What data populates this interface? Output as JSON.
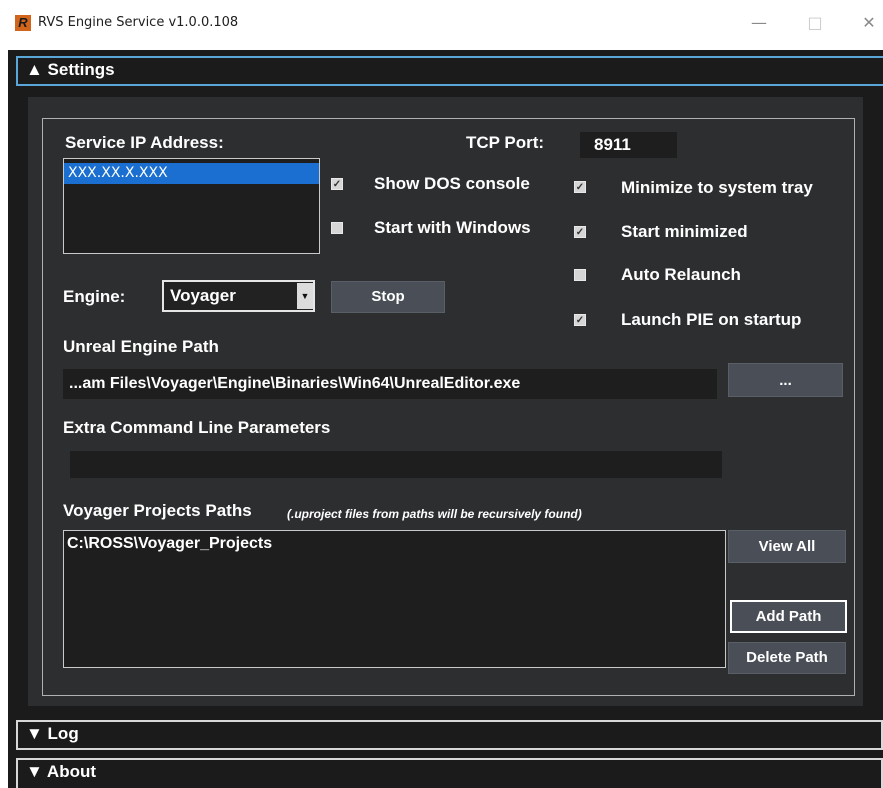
{
  "window": {
    "title": "RVS Engine Service v1.0.0.108",
    "logo_letter": "R",
    "minimize": "—",
    "maximize": "□",
    "close": "✕"
  },
  "sections": {
    "settings": "▲  Settings",
    "log": "▼  Log",
    "about": "▼  About"
  },
  "settings": {
    "service_ip_label": "Service IP Address:",
    "ip_items": [
      "XXX.XX.X.XXX"
    ],
    "tcp_port_label": "TCP Port:",
    "tcp_port_value": "8911",
    "checkboxes": [
      {
        "label": "Show DOS console",
        "checked": true
      },
      {
        "label": "Start with Windows",
        "checked": false
      },
      {
        "label": "Minimize to system tray",
        "checked": true
      },
      {
        "label": "Start minimized",
        "checked": true
      },
      {
        "label": "Auto Relaunch",
        "checked": false
      },
      {
        "label": "Launch PIE on startup",
        "checked": true
      }
    ],
    "check_mark": "✓",
    "engine_label": "Engine:",
    "engine_value": "Voyager",
    "engine_arrow": "▼",
    "stop_label": "Stop",
    "unreal_path_label": "Unreal Engine Path",
    "unreal_path_value": "...am Files\\Voyager\\Engine\\Binaries\\Win64\\UnrealEditor.exe",
    "browse_label": "...",
    "extra_params_label": "Extra Command Line Parameters",
    "extra_params_value": "",
    "projects_label": "Voyager Projects Paths",
    "projects_note": "(.uproject files from paths will be recursively found)",
    "project_items": [
      "C:\\ROSS\\Voyager_Projects"
    ],
    "view_all_label": "View All",
    "add_path_label": "Add Path",
    "delete_path_label": "Delete Path"
  }
}
